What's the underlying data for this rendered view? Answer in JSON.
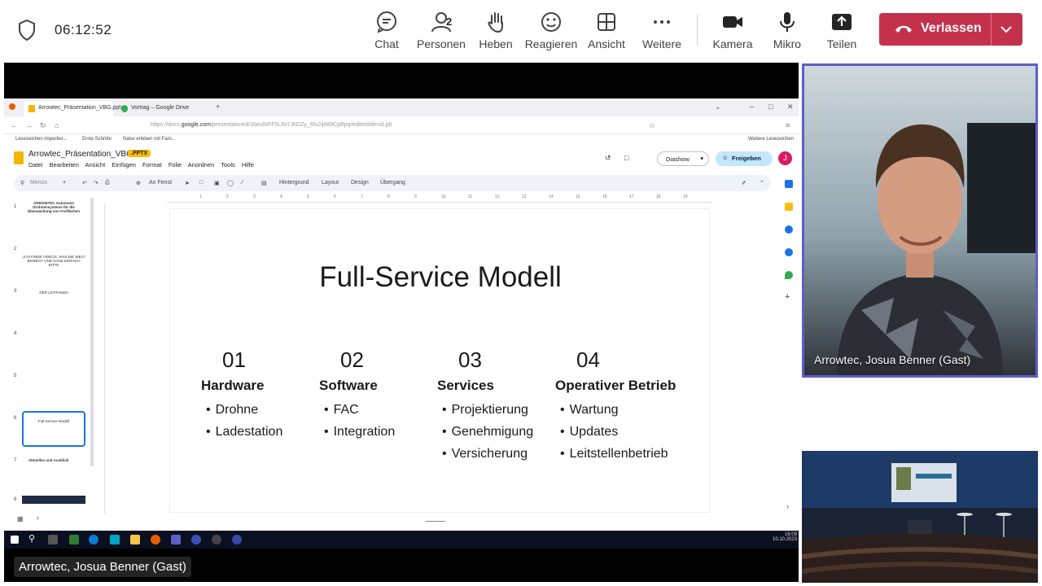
{
  "topbar": {
    "timer": "06:12:52",
    "buttons": [
      {
        "label": "Chat",
        "icon": "chat-icon"
      },
      {
        "label": "Personen",
        "icon": "people-icon",
        "count": "2"
      },
      {
        "label": "Heben",
        "icon": "raise-hand-icon"
      },
      {
        "label": "Reagieren",
        "icon": "react-icon"
      },
      {
        "label": "Ansicht",
        "icon": "view-icon"
      },
      {
        "label": "Weitere",
        "icon": "more-icon"
      },
      {
        "label": "Kamera",
        "icon": "camera-icon"
      },
      {
        "label": "Mikro",
        "icon": "mic-icon"
      },
      {
        "label": "Teilen",
        "icon": "share-icon"
      }
    ],
    "leave_label": "Verlassen",
    "leave_color": "#c4314b"
  },
  "browser": {
    "tabs": [
      "Arrowtec_Präsentation_VBG.pptx",
      "Vortrag – Google Drive"
    ],
    "url_prefix": "https://docs.",
    "url_domain": "google.com",
    "url_rest": "/presentation/d/1beu5rFF5L6v7JhDZy_6fu2ij889CpBpq/edit#slide=id.p6",
    "bookmarks": [
      "Lesezeichen importier...",
      "Erste Schritte",
      "Natur erleben mit Fam...",
      "Weitere Lesezeichen"
    ]
  },
  "slides_app": {
    "doc_title": "Arrowtec_Präsentation_VBG",
    "badge": ".PPTX",
    "menus": [
      "Datei",
      "Bearbeiten",
      "Ansicht",
      "Einfügen",
      "Format",
      "Folie",
      "Anordnen",
      "Tools",
      "Hilfe"
    ],
    "diashow_label": "Diashow",
    "share_label": "Freigeben",
    "avatar_letter": "J",
    "toolbar": {
      "menus_placeholder": "Menüs",
      "zoom_label": "An Fenst",
      "background": "Hintergrund",
      "layout": "Layout",
      "design": "Design",
      "transition": "Übergang"
    },
    "ruler_ticks": [
      "1",
      "2",
      "3",
      "4",
      "5",
      "6",
      "7",
      "8",
      "9",
      "10",
      "11",
      "12",
      "13",
      "14",
      "15",
      "16",
      "17",
      "18",
      "19"
    ],
    "thumbnails": [
      {
        "num": "1",
        "text": "ARROWTEC Autonome Drohnensysteme für die Überwachung von Freiflächen"
      },
      {
        "num": "2",
        "text": "„ICH FINDE VIDEOS, WAS DIE WELT BEWEGT UND GANZ EINFACH BITTE"
      },
      {
        "num": "3",
        "text": "DER LEITFADEN"
      },
      {
        "num": "4",
        "text": ""
      },
      {
        "num": "5",
        "text": ""
      },
      {
        "num": "6",
        "text": "Full-Service Modell"
      },
      {
        "num": "7",
        "text": "Aktuelles und Ausblick"
      },
      {
        "num": "8",
        "text": ""
      }
    ]
  },
  "slide": {
    "title": "Full-Service Modell",
    "columns": [
      {
        "num": "01",
        "head": "Hardware",
        "items": [
          "Drohne",
          "Ladestation"
        ]
      },
      {
        "num": "02",
        "head": "Software",
        "items": [
          "FAC",
          "Integration"
        ]
      },
      {
        "num": "03",
        "head": "Services",
        "items": [
          "Projektierung",
          "Genehmigung",
          "Versicherung"
        ]
      },
      {
        "num": "04",
        "head": "Operativer Betrieb",
        "items": [
          "Wartung",
          "Updates",
          "Leitstellenbetrieb"
        ]
      }
    ]
  },
  "taskbar": {
    "time": "16:09",
    "date": "10.10.2023"
  },
  "participants": {
    "presenter_name": "Arrowtec, Josua Benner (Gast)",
    "camera_name": "Arrowtec, Josua Benner (Gast)"
  },
  "colors": {
    "accent": "#5b5fc7",
    "slides_yellow": "#f4b400",
    "share_blue": "#c2e7ff"
  }
}
